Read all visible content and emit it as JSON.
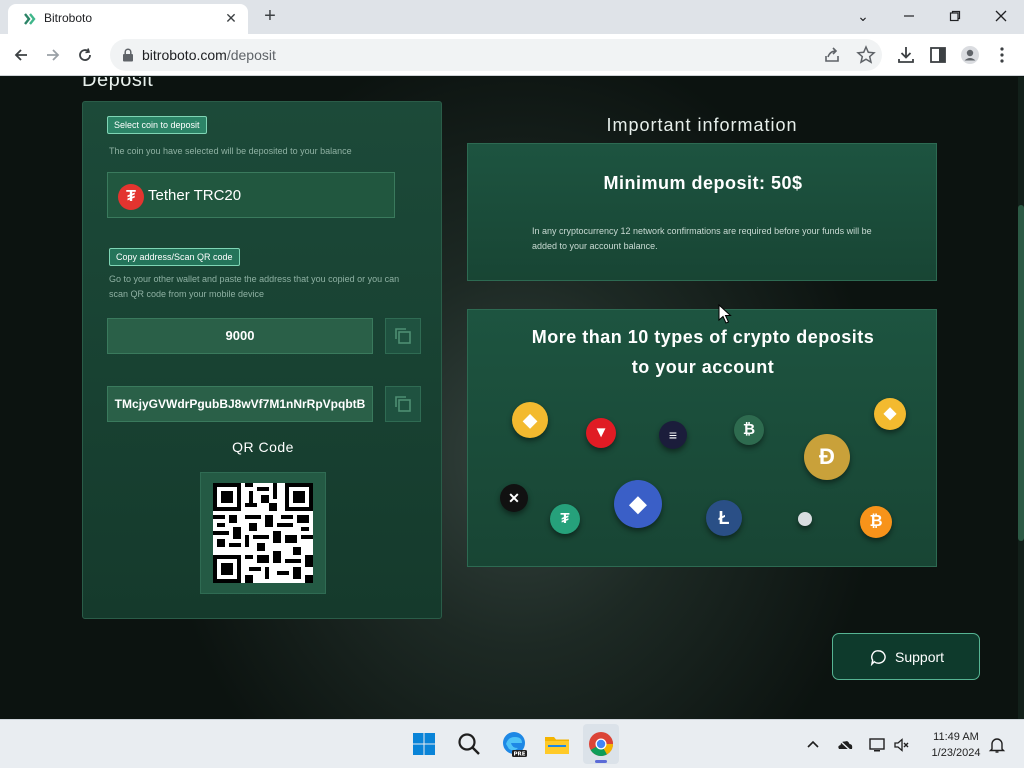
{
  "browser": {
    "tab_title": "Bitroboto",
    "url_host": "bitroboto.com",
    "url_path": "/deposit",
    "new_tab_symbol": "+",
    "close_symbol": "✕"
  },
  "page": {
    "heading": "Deposit",
    "select_coin_label": "Select coin to deposit",
    "select_hint": "The coin you have selected will be deposited to your balance",
    "selected_coin": "Tether TRC20",
    "copy_label": "Copy address/Scan QR code",
    "copy_hint": "Go to your other wallet and paste the address that you copied or you can scan QR code from your mobile device",
    "amount_value": "9000",
    "address_value": "TMcjyGVWdrPgubBJ8wVf7M1nNrRpVpqbtB",
    "qr_title": "QR Code"
  },
  "info": {
    "title": "Important information",
    "min_deposit": "Minimum deposit: 50$",
    "confirmations_text": "In any cryptocurrency 12 network confirmations are required before your funds will be added to your account balance.",
    "crypto_title": "More than 10 types of crypto deposits to your account"
  },
  "coins": [
    {
      "name": "bnb-coin-icon",
      "color": "#f3ba2f",
      "glyph": "◆"
    },
    {
      "name": "tron-coin-icon",
      "color": "#e01b24",
      "glyph": "▼"
    },
    {
      "name": "solana-coin-icon",
      "color": "#1b1d3b",
      "glyph": "≡"
    },
    {
      "name": "bitcoin-green-coin-icon",
      "color": "#2e6b4f",
      "glyph": "₿"
    },
    {
      "name": "bnb-small-coin-icon",
      "color": "#f3ba2f",
      "glyph": "◆"
    },
    {
      "name": "dogecoin-icon",
      "color": "#c9a13a",
      "glyph": "Ð"
    },
    {
      "name": "xrp-coin-icon",
      "color": "#111111",
      "glyph": "✕"
    },
    {
      "name": "tether-coin-icon",
      "color": "#26a17b",
      "glyph": "₮"
    },
    {
      "name": "ethereum-coin-icon",
      "color": "#3a5fc7",
      "glyph": "◆"
    },
    {
      "name": "litecoin-icon",
      "color": "#2a4f86",
      "glyph": "Ł"
    },
    {
      "name": "small-grey-coin-icon",
      "color": "#d8dde0",
      "glyph": ""
    },
    {
      "name": "bitcoin-orange-coin-icon",
      "color": "#f7931a",
      "glyph": "₿"
    }
  ],
  "support": {
    "label": "Support"
  },
  "taskbar": {
    "time": "11:49 AM",
    "date": "1/23/2024"
  },
  "colors": {
    "accent": "#2c8467",
    "panel": "#1c4a39",
    "support_border": "#56b493"
  }
}
